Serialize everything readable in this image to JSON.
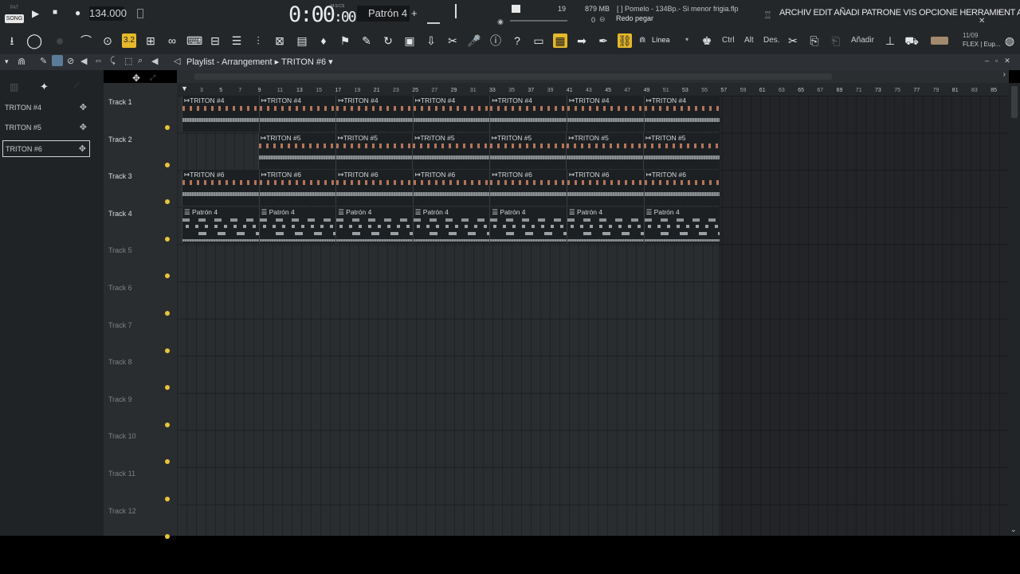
{
  "topbar": {
    "pat_label": "PAT",
    "song_label": "SONG",
    "tempo": "134.000",
    "time": "0:00",
    "time_sub": ":00",
    "time_units": "M:S:CS",
    "pattern": "Patrón 4",
    "cpu": "19",
    "memory": "879 MB",
    "polyphony": "0",
    "project_title": "[   ] Pomelo - 134Bp.- Si menor frigia.flp",
    "hint": "Redo pegar",
    "menus": "ARCHIV EDIT AÑADI PATRONE VIS OPCIONE HERRAMIENT A",
    "window_controls": "– ▫ ✕"
  },
  "toolbar": {
    "snap_value": "3.2",
    "line_label": "Línea",
    "ctrl": "Ctrl",
    "alt": "Alt",
    "des": "Des.",
    "add": "Añadir",
    "date": "11/09",
    "flex": "FLEX | Eup..."
  },
  "playlist": {
    "title": "Playlist - Arrangement",
    "pattern_breadcrumb": "TRITON #6"
  },
  "clip_list": [
    {
      "label": "TRITON #4"
    },
    {
      "label": "TRITON #5"
    },
    {
      "label": "TRITON #6"
    }
  ],
  "tracks": [
    {
      "name": "Track 1"
    },
    {
      "name": "Track 2"
    },
    {
      "name": "Track 3"
    },
    {
      "name": "Track 4"
    },
    {
      "name": "Track 5"
    },
    {
      "name": "Track 6"
    },
    {
      "name": "Track 7"
    },
    {
      "name": "Track 8"
    },
    {
      "name": "Track 9"
    },
    {
      "name": "Track 10"
    },
    {
      "name": "Track 11"
    },
    {
      "name": "Track 12"
    }
  ],
  "ruler": [
    "3",
    "5",
    "7",
    "9",
    "11",
    "13",
    "15",
    "17",
    "19",
    "21",
    "23",
    "25",
    "27",
    "29",
    "31",
    "33",
    "35",
    "37",
    "39",
    "41",
    "43",
    "45",
    "47",
    "49",
    "51",
    "53",
    "55",
    "57",
    "59",
    "61",
    "63",
    "65",
    "67",
    "69",
    "71",
    "73",
    "75",
    "77",
    "79",
    "81",
    "83",
    "85"
  ],
  "clips": {
    "track1": "TRITON #4",
    "track2": "TRITON #5",
    "track3": "TRITON #6",
    "track4": "Patrón 4"
  },
  "colors": {
    "accent": "#e6b92a",
    "track_dot": "#e9c53a",
    "note": "#d98a6a"
  }
}
